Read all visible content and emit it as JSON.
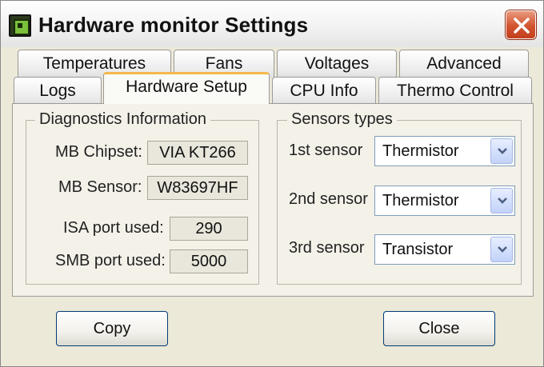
{
  "window": {
    "title": "Hardware monitor Settings",
    "icon": "hardware-chip-icon",
    "close_icon": "close-icon"
  },
  "tabs": {
    "row1": [
      {
        "label": "Temperatures"
      },
      {
        "label": "Fans"
      },
      {
        "label": "Voltages"
      },
      {
        "label": "Advanced"
      }
    ],
    "row2": [
      {
        "label": "Logs"
      },
      {
        "label": "Hardware Setup",
        "active": true
      },
      {
        "label": "CPU Info"
      },
      {
        "label": "Thermo Control"
      }
    ]
  },
  "diagnostics": {
    "legend": "Diagnostics Information",
    "mb_chipset_label": "MB Chipset:",
    "mb_chipset_value": "VIA KT266",
    "mb_sensor_label": "MB Sensor:",
    "mb_sensor_value": "W83697HF",
    "isa_port_label": "ISA port used:",
    "isa_port_value": "290",
    "smb_port_label": "SMB port used:",
    "smb_port_value": "5000"
  },
  "sensors": {
    "legend": "Sensors types",
    "items": [
      {
        "label": "1st sensor",
        "value": "Thermistor"
      },
      {
        "label": "2nd sensor",
        "value": "Thermistor"
      },
      {
        "label": "3rd sensor",
        "value": "Transistor"
      }
    ]
  },
  "buttons": {
    "copy": "Copy",
    "close": "Close"
  },
  "colors": {
    "face": "#ECE9D8",
    "active_tab_accent": "#f6b84a",
    "close_button": "#d2532f",
    "button_border": "#003c74"
  }
}
